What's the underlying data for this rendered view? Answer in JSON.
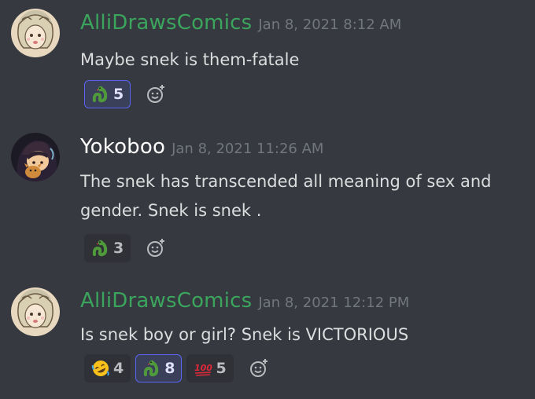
{
  "colors": {
    "background": "#36393f",
    "username_green": "#3ba55d",
    "timestamp": "#72767d",
    "text": "#dcddde",
    "reaction_bg": "#2f3136",
    "reaction_selected_bg": "#3b405a",
    "reaction_selected_border": "#5865f2"
  },
  "messages": [
    {
      "username": "AlliDrawsComics",
      "timestamp": "Jan 8, 2021 8:12 AM",
      "text": "Maybe snek is them-fatale",
      "reactions": [
        {
          "emoji": "snek-emoji",
          "count": "5",
          "selected": true
        }
      ]
    },
    {
      "username": "Yokoboo",
      "timestamp": "Jan 8, 2021 11:26 AM",
      "text": "The snek has transcended all meaning of sex and gender. Snek is snek .",
      "reactions": [
        {
          "emoji": "snek-emoji",
          "count": "3",
          "selected": false
        }
      ]
    },
    {
      "username": "AlliDrawsComics",
      "timestamp": "Jan 8, 2021 12:12 PM",
      "text": "Is snek boy or girl? Snek is VICTORIOUS",
      "reactions": [
        {
          "emoji": "rofl-emoji",
          "count": "4",
          "selected": false
        },
        {
          "emoji": "snek-emoji",
          "count": "8",
          "selected": true
        },
        {
          "emoji": "hundred-emoji",
          "count": "5",
          "selected": false
        }
      ]
    }
  ]
}
